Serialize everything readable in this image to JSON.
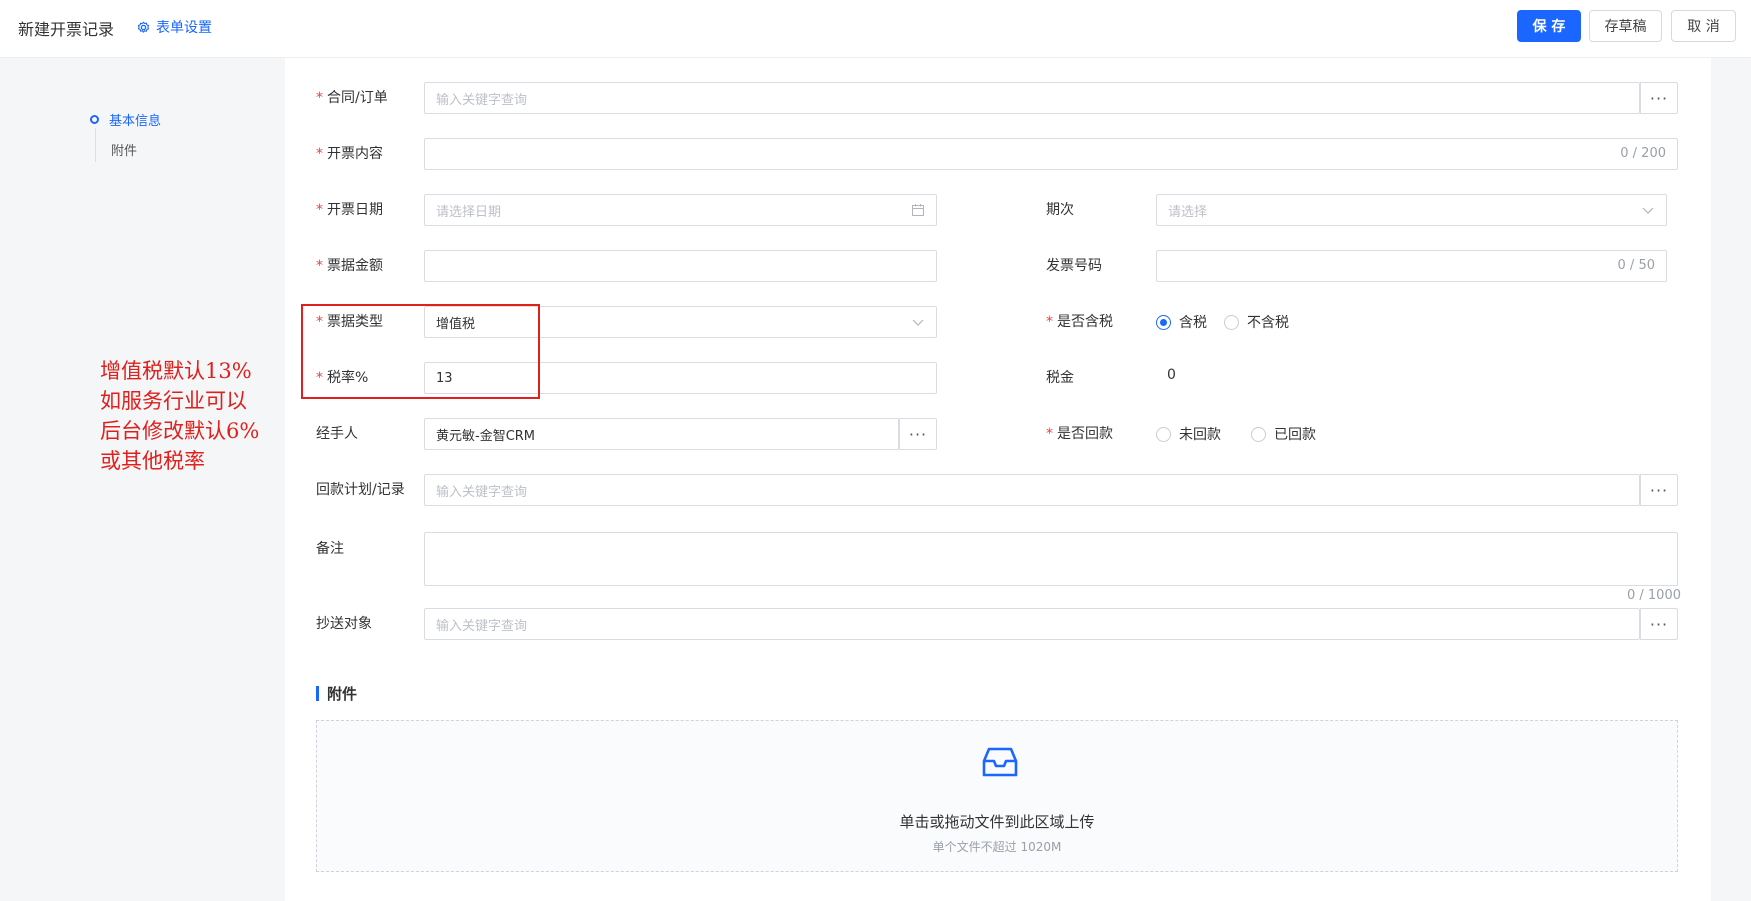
{
  "header": {
    "title": "新建开票记录",
    "form_settings": "表单设置",
    "save": "保 存",
    "draft": "存草稿",
    "cancel": "取 消"
  },
  "nav": {
    "items": [
      {
        "label": "基本信息",
        "active": true
      },
      {
        "label": "附件",
        "active": false
      }
    ]
  },
  "annotation": {
    "lines": [
      "增值税默认13%",
      "如服务行业可以",
      "后台修改默认6%",
      "或其他税率"
    ]
  },
  "form": {
    "contract": {
      "label": "合同/订单",
      "placeholder": "输入关键字查询"
    },
    "content": {
      "label": "开票内容",
      "counter": "0 / 200"
    },
    "date": {
      "label": "开票日期",
      "placeholder": "请选择日期"
    },
    "period": {
      "label": "期次",
      "placeholder": "请选择"
    },
    "amount": {
      "label": "票据金额",
      "value": ""
    },
    "invoice_no": {
      "label": "发票号码",
      "counter": "0 / 50"
    },
    "bill_type": {
      "label": "票据类型",
      "value": "增值税"
    },
    "tax_included": {
      "label": "是否含税",
      "options": [
        "含税",
        "不含税"
      ],
      "selected": "含税"
    },
    "tax_rate": {
      "label": "税率%",
      "value": "13"
    },
    "tax": {
      "label": "税金",
      "value": "0"
    },
    "handler": {
      "label": "经手人",
      "value": "黄元敏-金智CRM"
    },
    "returned": {
      "label": "是否回款",
      "options": [
        "未回款",
        "已回款"
      ],
      "selected": ""
    },
    "payment_plan": {
      "label": "回款计划/记录",
      "placeholder": "输入关键字查询"
    },
    "remark": {
      "label": "备注",
      "counter": "0 / 1000"
    },
    "cc": {
      "label": "抄送对象",
      "placeholder": "输入关键字查询"
    }
  },
  "attachments": {
    "title": "附件",
    "upload_text": "单击或拖动文件到此区域上传",
    "upload_hint": "单个文件不超过 1020M"
  },
  "colors": {
    "primary": "#1a66ff",
    "required": "#f03e3e",
    "annotation": "#e0201d"
  },
  "icons": [
    "gear-icon",
    "calendar-icon",
    "chevron-down-icon",
    "more-icon",
    "inbox-icon"
  ]
}
